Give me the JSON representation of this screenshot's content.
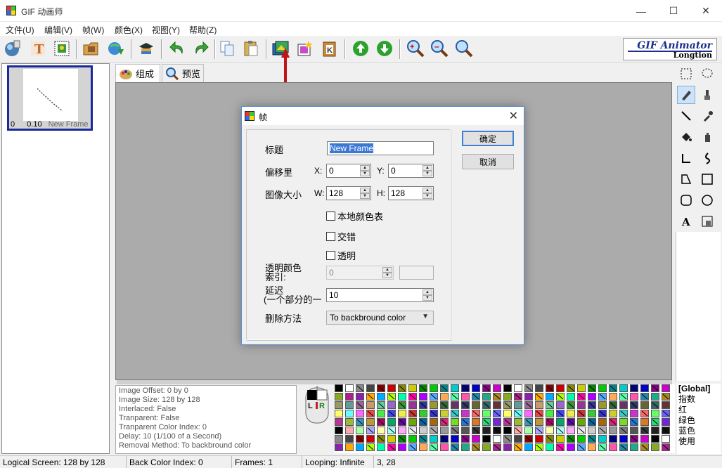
{
  "window": {
    "title": "GIF 动画师",
    "minimize": "—",
    "maximize": "☐",
    "close": "✕"
  },
  "menu": [
    "文件(U)",
    "编辑(V)",
    "帧(W)",
    "颜色(X)",
    "视图(Y)",
    "帮助(Z)"
  ],
  "logo": {
    "line1": "GIF Animator",
    "line2": "Longtion"
  },
  "frames": [
    {
      "index": "0",
      "delay": "0.10",
      "name": "New Frame"
    }
  ],
  "tabs": [
    {
      "label": "组成"
    },
    {
      "label": "预览"
    }
  ],
  "dialog": {
    "title": "帧",
    "title_label": "标题",
    "title_value": "New Frame",
    "offset_label": "偏移里",
    "x_label": "X:",
    "x_value": "0",
    "y_label": "Y:",
    "y_value": "0",
    "size_label": "图像大小",
    "w_label": "W:",
    "w_value": "128",
    "h_label": "H:",
    "h_value": "128",
    "local_palette": "本地颜色表",
    "interlace": "交错",
    "transparent": "透明",
    "transparent_index_label_1": "透明颜色",
    "transparent_index_label_2": "索引:",
    "transparent_index_value": "0",
    "delay_label_1": "延迟",
    "delay_label_2": "(一个部分的一",
    "delay_value": "10",
    "removal_label": "删除方法",
    "removal_value": "To backbround color",
    "ok": "确定",
    "cancel": "取消"
  },
  "info": {
    "image_offset": "Image Offset: 0 by 0",
    "image_size": "Image Size: 128 by 128",
    "interlaced": "Interlaced: False",
    "tranparent": "Tranparent: False",
    "tranparent_index": "Tranparent Color Index: 0",
    "delay": "Delay: 10 (1/100 of a Second)",
    "removal": "Removal Method: To backbround color"
  },
  "color_names": [
    "[Global]",
    "指数",
    "红",
    "绿色",
    "蓝色",
    "使用"
  ],
  "mouse": {
    "left": "L",
    "right": "R"
  },
  "status": {
    "logical_screen": "Logical Screen: 128 by 128",
    "back_color_index": "Back Color Index: 0",
    "frames": "Frames: 1",
    "looping": "Looping: Infinite",
    "coords": "3, 28"
  },
  "colors": {
    "accent": "#3f7fd6",
    "selection": "#3b78d4",
    "frame_border": "#1a2a9a",
    "arrow": "#c0141a"
  },
  "icons": [
    "globe-icon",
    "text-tool-icon",
    "image-stamp-icon",
    "open-folder-icon",
    "save-globe-icon",
    "wizard-icon",
    "undo-icon",
    "redo-icon",
    "copy-icon",
    "paste-icon",
    "frame-props-icon",
    "add-frame-icon",
    "clipboard-frame-icon",
    "move-up-icon",
    "move-down-icon",
    "zoom-in-icon",
    "zoom-out-icon",
    "zoom-icon"
  ]
}
